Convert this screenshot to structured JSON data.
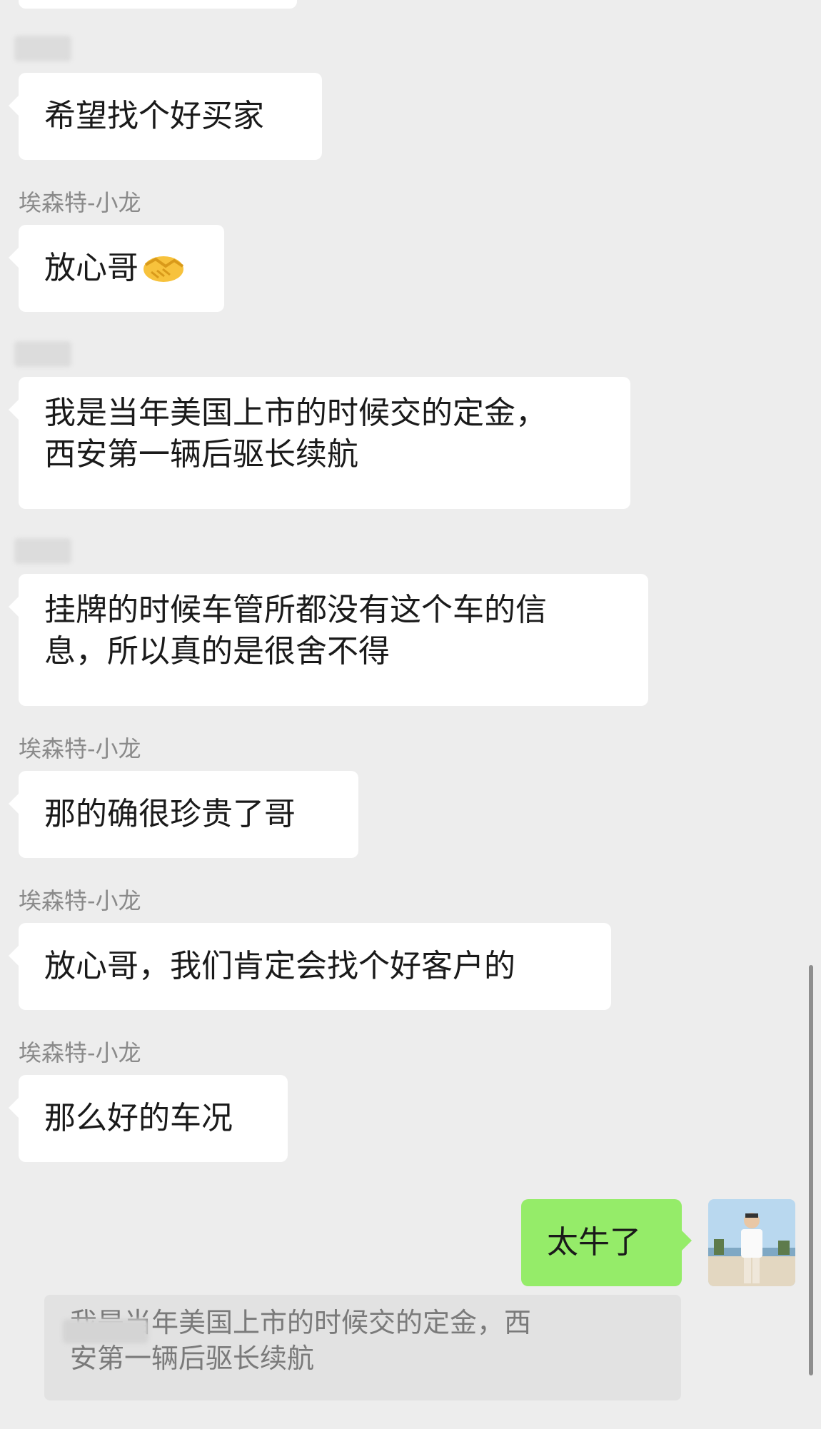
{
  "messages": [
    {
      "sender": "",
      "text": "希望找个好买家"
    },
    {
      "sender": "埃森特-小龙",
      "text": "放心哥"
    },
    {
      "sender": "",
      "line1": "我是当年美国上市的时候交的定金，",
      "line2": "西安第一辆后驱长续航"
    },
    {
      "sender": "",
      "line1": "挂牌的时候车管所都没有这个车的信",
      "line2": "息，所以真的是很舍不得"
    },
    {
      "sender": "埃森特-小龙",
      "text": "那的确很珍贵了哥"
    },
    {
      "sender": "埃森特-小龙",
      "text": "放心哥，我们肯定会找个好客户的"
    },
    {
      "sender": "埃森特-小龙",
      "text": "那么好的车况"
    }
  ],
  "my_message": {
    "text": "太牛了"
  },
  "quote": {
    "line1": "我是当年美国上市的时候交的定金，西",
    "line2": "安第一辆后驱长续航"
  },
  "icons": {
    "handshake": "handshake-emoji",
    "avatar": "user-avatar"
  },
  "colors": {
    "background": "#ededed",
    "bubble": "#ffffff",
    "mine": "#95ec69",
    "sender": "#8a8a8a"
  }
}
